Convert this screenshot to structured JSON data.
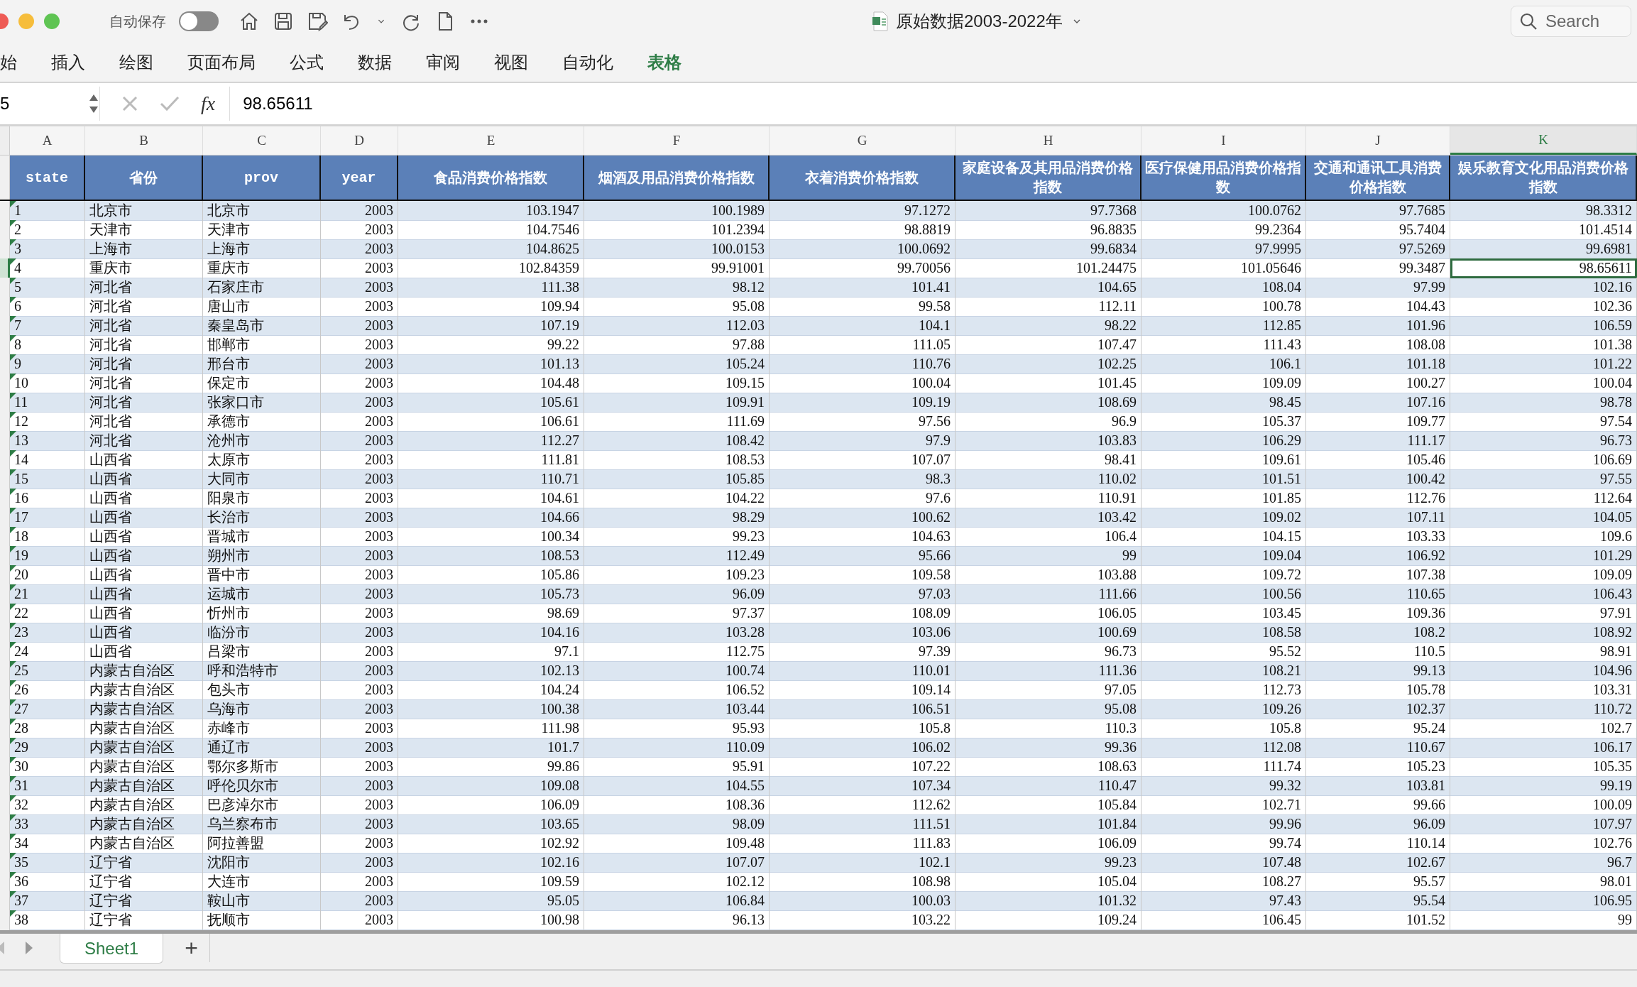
{
  "titlebar": {
    "autosave_label": "自动保存",
    "autosave_on": false,
    "title": "原始数据2003-2022年",
    "search": {
      "placeholder": "Search"
    }
  },
  "ribbon_tabs": [
    {
      "label": "始",
      "selected": false
    },
    {
      "label": "插入",
      "selected": false
    },
    {
      "label": "绘图",
      "selected": false
    },
    {
      "label": "页面布局",
      "selected": false
    },
    {
      "label": "公式",
      "selected": false
    },
    {
      "label": "数据",
      "selected": false
    },
    {
      "label": "审阅",
      "selected": false
    },
    {
      "label": "视图",
      "selected": false
    },
    {
      "label": "自动化",
      "selected": false
    },
    {
      "label": "表格",
      "selected": true
    }
  ],
  "formula_bar": {
    "name_box": "5",
    "fx": "fx",
    "value": "98.65611"
  },
  "sheet": {
    "columns": [
      {
        "letter": "A",
        "header": "state",
        "kind": "text",
        "selected": false
      },
      {
        "letter": "B",
        "header": "省份",
        "kind": "text",
        "selected": false
      },
      {
        "letter": "C",
        "header": "prov",
        "kind": "text",
        "selected": false
      },
      {
        "letter": "D",
        "header": "year",
        "kind": "number",
        "selected": false
      },
      {
        "letter": "E",
        "header": "食品消费价格指数",
        "kind": "number",
        "selected": false
      },
      {
        "letter": "F",
        "header": "烟酒及用品消费价格指数",
        "kind": "number",
        "selected": false
      },
      {
        "letter": "G",
        "header": "衣着消费价格指数",
        "kind": "number",
        "selected": false
      },
      {
        "letter": "H",
        "header": "家庭设备及其用品消费价格指数",
        "kind": "number",
        "selected": false
      },
      {
        "letter": "I",
        "header": "医疗保健用品消费价格指数",
        "kind": "number",
        "selected": false
      },
      {
        "letter": "J",
        "header": "交通和通讯工具消费价格指数",
        "kind": "number",
        "selected": false
      },
      {
        "letter": "K",
        "header": "娱乐教育文化用品消费价格指数",
        "kind": "number",
        "selected": true
      }
    ],
    "rows": [
      {
        "selected": false,
        "cells": [
          "1",
          "北京市",
          "北京市",
          "2003",
          "103.1947",
          "100.1989",
          "97.1272",
          "97.7368",
          "100.0762",
          "97.7685",
          "98.3312"
        ]
      },
      {
        "selected": false,
        "cells": [
          "2",
          "天津市",
          "天津市",
          "2003",
          "104.7546",
          "101.2394",
          "98.8819",
          "96.8835",
          "99.2364",
          "95.7404",
          "101.4514"
        ]
      },
      {
        "selected": false,
        "cells": [
          "3",
          "上海市",
          "上海市",
          "2003",
          "104.8625",
          "100.0153",
          "100.0692",
          "99.6834",
          "97.9995",
          "97.5269",
          "99.6981"
        ]
      },
      {
        "selected": true,
        "cells": [
          "4",
          "重庆市",
          "重庆市",
          "2003",
          "102.84359",
          "99.91001",
          "99.70056",
          "101.24475",
          "101.05646",
          "99.3487",
          "98.65611"
        ]
      },
      {
        "selected": false,
        "cells": [
          "5",
          "河北省",
          "石家庄市",
          "2003",
          "111.38",
          "98.12",
          "101.41",
          "104.65",
          "108.04",
          "97.99",
          "102.16"
        ]
      },
      {
        "selected": false,
        "cells": [
          "6",
          "河北省",
          "唐山市",
          "2003",
          "109.94",
          "95.08",
          "99.58",
          "112.11",
          "100.78",
          "104.43",
          "102.36"
        ]
      },
      {
        "selected": false,
        "cells": [
          "7",
          "河北省",
          "秦皇岛市",
          "2003",
          "107.19",
          "112.03",
          "104.1",
          "98.22",
          "112.85",
          "101.96",
          "106.59"
        ]
      },
      {
        "selected": false,
        "cells": [
          "8",
          "河北省",
          "邯郸市",
          "2003",
          "99.22",
          "97.88",
          "111.05",
          "107.47",
          "111.43",
          "108.08",
          "101.38"
        ]
      },
      {
        "selected": false,
        "cells": [
          "9",
          "河北省",
          "邢台市",
          "2003",
          "101.13",
          "105.24",
          "110.76",
          "102.25",
          "106.1",
          "101.18",
          "101.22"
        ]
      },
      {
        "selected": false,
        "cells": [
          "10",
          "河北省",
          "保定市",
          "2003",
          "104.48",
          "109.15",
          "100.04",
          "101.45",
          "109.09",
          "100.27",
          "100.04"
        ]
      },
      {
        "selected": false,
        "cells": [
          "11",
          "河北省",
          "张家口市",
          "2003",
          "105.61",
          "109.91",
          "109.19",
          "108.69",
          "98.45",
          "107.16",
          "98.78"
        ]
      },
      {
        "selected": false,
        "cells": [
          "12",
          "河北省",
          "承德市",
          "2003",
          "106.61",
          "111.69",
          "97.56",
          "96.9",
          "105.37",
          "109.77",
          "97.54"
        ]
      },
      {
        "selected": false,
        "cells": [
          "13",
          "河北省",
          "沧州市",
          "2003",
          "112.27",
          "108.42",
          "97.9",
          "103.83",
          "106.29",
          "111.17",
          "96.73"
        ]
      },
      {
        "selected": false,
        "cells": [
          "14",
          "山西省",
          "太原市",
          "2003",
          "111.81",
          "108.53",
          "107.07",
          "98.41",
          "109.61",
          "105.46",
          "106.69"
        ]
      },
      {
        "selected": false,
        "cells": [
          "15",
          "山西省",
          "大同市",
          "2003",
          "110.71",
          "105.85",
          "98.3",
          "110.02",
          "101.51",
          "100.42",
          "97.55"
        ]
      },
      {
        "selected": false,
        "cells": [
          "16",
          "山西省",
          "阳泉市",
          "2003",
          "104.61",
          "104.22",
          "97.6",
          "110.91",
          "101.85",
          "112.76",
          "112.64"
        ]
      },
      {
        "selected": false,
        "cells": [
          "17",
          "山西省",
          "长治市",
          "2003",
          "104.66",
          "98.29",
          "100.62",
          "103.42",
          "109.02",
          "107.11",
          "104.05"
        ]
      },
      {
        "selected": false,
        "cells": [
          "18",
          "山西省",
          "晋城市",
          "2003",
          "100.34",
          "99.23",
          "104.63",
          "106.4",
          "104.15",
          "103.33",
          "109.6"
        ]
      },
      {
        "selected": false,
        "cells": [
          "19",
          "山西省",
          "朔州市",
          "2003",
          "108.53",
          "112.49",
          "95.66",
          "99",
          "109.04",
          "106.92",
          "101.29"
        ]
      },
      {
        "selected": false,
        "cells": [
          "20",
          "山西省",
          "晋中市",
          "2003",
          "105.86",
          "109.23",
          "109.58",
          "103.88",
          "109.72",
          "107.38",
          "109.09"
        ]
      },
      {
        "selected": false,
        "cells": [
          "21",
          "山西省",
          "运城市",
          "2003",
          "105.73",
          "96.09",
          "97.03",
          "111.66",
          "100.56",
          "110.65",
          "106.43"
        ]
      },
      {
        "selected": false,
        "cells": [
          "22",
          "山西省",
          "忻州市",
          "2003",
          "98.69",
          "97.37",
          "108.09",
          "106.05",
          "103.45",
          "109.36",
          "97.91"
        ]
      },
      {
        "selected": false,
        "cells": [
          "23",
          "山西省",
          "临汾市",
          "2003",
          "104.16",
          "103.28",
          "103.06",
          "100.69",
          "108.58",
          "108.2",
          "108.92"
        ]
      },
      {
        "selected": false,
        "cells": [
          "24",
          "山西省",
          "吕梁市",
          "2003",
          "97.1",
          "112.75",
          "97.39",
          "96.73",
          "95.52",
          "110.5",
          "98.91"
        ]
      },
      {
        "selected": false,
        "cells": [
          "25",
          "内蒙古自治区",
          "呼和浩特市",
          "2003",
          "102.13",
          "100.74",
          "110.01",
          "111.36",
          "108.21",
          "99.13",
          "104.96"
        ]
      },
      {
        "selected": false,
        "cells": [
          "26",
          "内蒙古自治区",
          "包头市",
          "2003",
          "104.24",
          "106.52",
          "109.14",
          "97.05",
          "112.73",
          "105.78",
          "103.31"
        ]
      },
      {
        "selected": false,
        "cells": [
          "27",
          "内蒙古自治区",
          "乌海市",
          "2003",
          "100.38",
          "103.44",
          "106.51",
          "95.08",
          "109.26",
          "102.37",
          "110.72"
        ]
      },
      {
        "selected": false,
        "cells": [
          "28",
          "内蒙古自治区",
          "赤峰市",
          "2003",
          "111.98",
          "95.93",
          "105.8",
          "110.3",
          "105.8",
          "95.24",
          "102.7"
        ]
      },
      {
        "selected": false,
        "cells": [
          "29",
          "内蒙古自治区",
          "通辽市",
          "2003",
          "101.7",
          "110.09",
          "106.02",
          "99.36",
          "112.08",
          "110.67",
          "106.17"
        ]
      },
      {
        "selected": false,
        "cells": [
          "30",
          "内蒙古自治区",
          "鄂尔多斯市",
          "2003",
          "99.86",
          "95.91",
          "107.22",
          "108.63",
          "111.74",
          "105.23",
          "105.35"
        ]
      },
      {
        "selected": false,
        "cells": [
          "31",
          "内蒙古自治区",
          "呼伦贝尔市",
          "2003",
          "109.08",
          "104.55",
          "107.34",
          "110.47",
          "99.32",
          "103.81",
          "99.19"
        ]
      },
      {
        "selected": false,
        "cells": [
          "32",
          "内蒙古自治区",
          "巴彦淖尔市",
          "2003",
          "106.09",
          "108.36",
          "112.62",
          "105.84",
          "102.71",
          "99.66",
          "100.09"
        ]
      },
      {
        "selected": false,
        "cells": [
          "33",
          "内蒙古自治区",
          "乌兰察布市",
          "2003",
          "103.65",
          "98.09",
          "111.51",
          "101.84",
          "99.96",
          "96.09",
          "107.97"
        ]
      },
      {
        "selected": false,
        "cells": [
          "34",
          "内蒙古自治区",
          "阿拉善盟",
          "2003",
          "102.92",
          "109.48",
          "111.83",
          "106.09",
          "99.74",
          "110.14",
          "102.76"
        ]
      },
      {
        "selected": false,
        "cells": [
          "35",
          "辽宁省",
          "沈阳市",
          "2003",
          "102.16",
          "107.07",
          "102.1",
          "99.23",
          "107.48",
          "102.67",
          "96.7"
        ]
      },
      {
        "selected": false,
        "cells": [
          "36",
          "辽宁省",
          "大连市",
          "2003",
          "109.59",
          "102.12",
          "108.98",
          "105.04",
          "108.27",
          "95.57",
          "98.01"
        ]
      },
      {
        "selected": false,
        "cells": [
          "37",
          "辽宁省",
          "鞍山市",
          "2003",
          "95.05",
          "106.84",
          "100.03",
          "101.32",
          "97.43",
          "95.54",
          "106.95"
        ]
      },
      {
        "selected": false,
        "cells": [
          "38",
          "辽宁省",
          "抚顺市",
          "2003",
          "100.98",
          "96.13",
          "103.22",
          "109.24",
          "106.45",
          "101.52",
          "99"
        ]
      }
    ]
  },
  "sheet_tabs": [
    {
      "label": "Sheet1",
      "selected": true
    }
  ],
  "add_sheet": "+"
}
